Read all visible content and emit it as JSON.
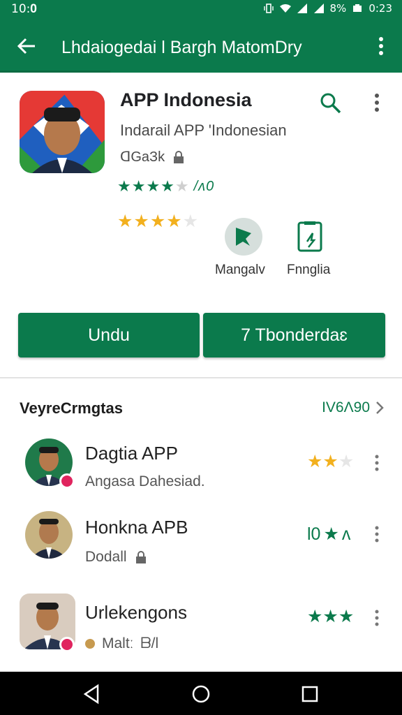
{
  "status_bar": {
    "time": "10:𝟎",
    "battery_text": "8%",
    "clock_right": "0:23"
  },
  "app_bar": {
    "title": "Lhdaiogedai l Bargh MatomDry"
  },
  "app": {
    "name": "APP Indonesia",
    "subtitle": "Indarail APP 'Indonesian",
    "meta": "ꓷGaЗk",
    "green_rating": {
      "stars": 4,
      "max": 5,
      "text": "/ᴧ0"
    },
    "gold_rating": {
      "stars": 4,
      "max": 5
    }
  },
  "actions": [
    {
      "label": "Mangalv",
      "icon": "map-pin-icon"
    },
    {
      "label": "Fnnglia",
      "icon": "phone-document-icon"
    }
  ],
  "buttons": {
    "primary": "Undu",
    "secondary": "7 Tbonderdaɛ"
  },
  "section": {
    "title": "VeyreCrmgtas",
    "more": "IV6Ʌ90"
  },
  "list": [
    {
      "title": "Daɡtia APP",
      "sub": "Angasa Dahesiad.",
      "rating_text": "",
      "rating_color": "#f2b01e"
    },
    {
      "title": "Honkna APB",
      "sub": "Dodall",
      "rating_text": "l0",
      "rating_color": "#0b7a4c",
      "rating_suffix": "ᴧ"
    },
    {
      "title": "Urlekengons",
      "sub": "Maltː",
      "sub2": "ᗷ/l",
      "rating_text": "",
      "rating_color": "#0b7a4c"
    }
  ],
  "colors": {
    "primary": "#0b7a4c",
    "gold": "#f2b01e",
    "badge": "#e0245e"
  }
}
